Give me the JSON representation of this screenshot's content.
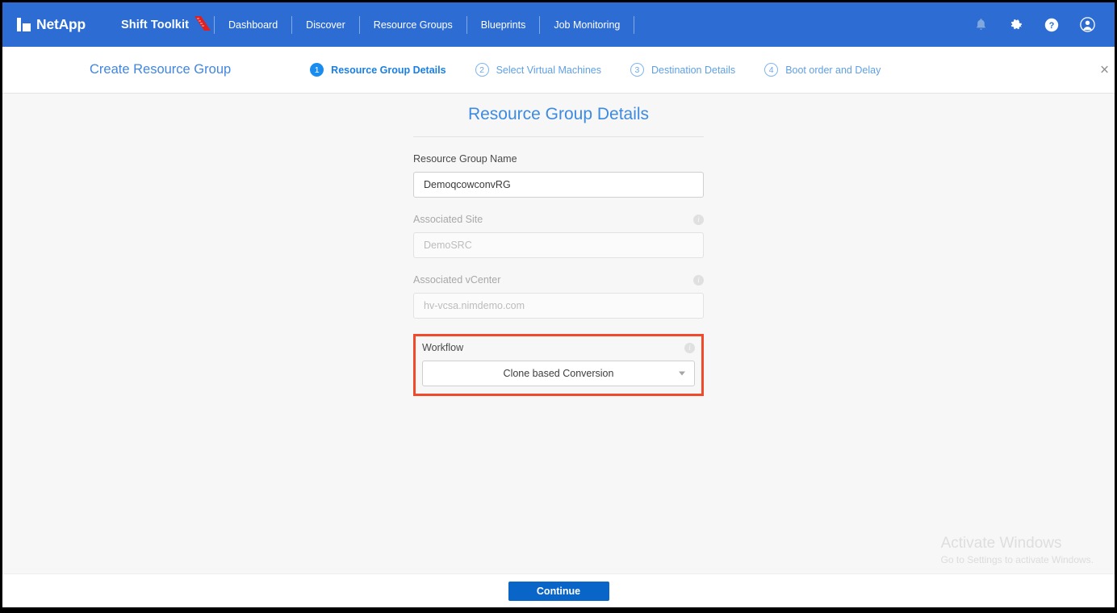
{
  "topnav": {
    "brand": "NetApp",
    "product": "Shift Toolkit",
    "links": [
      {
        "label": "Dashboard"
      },
      {
        "label": "Discover"
      },
      {
        "label": "Resource Groups"
      },
      {
        "label": "Blueprints"
      },
      {
        "label": "Job Monitoring"
      }
    ],
    "icons": {
      "notifications": "bell-icon",
      "settings": "gear-icon",
      "help": "help-icon",
      "account": "account-icon"
    },
    "colors": {
      "background": "#2d6cd2",
      "text": "#ffffff",
      "ribbon": "#e02020"
    }
  },
  "wizard": {
    "title": "Create Resource Group",
    "close_label": "×",
    "steps": [
      {
        "num": "1",
        "label": "Resource Group Details",
        "state": "active"
      },
      {
        "num": "2",
        "label": "Select Virtual Machines",
        "state": "idle"
      },
      {
        "num": "3",
        "label": "Destination Details",
        "state": "idle"
      },
      {
        "num": "4",
        "label": "Boot order and Delay",
        "state": "idle"
      }
    ]
  },
  "form": {
    "title": "Resource Group Details",
    "fields": {
      "resource_group_name": {
        "label": "Resource Group Name",
        "value": "DemoqcowconvRG",
        "placeholder": "Resource Group Name",
        "disabled": false,
        "has_info": false
      },
      "associated_site": {
        "label": "Associated Site",
        "value": "DemoSRC",
        "placeholder": "Associated Site",
        "disabled": true,
        "has_info": true
      },
      "associated_vcenter": {
        "label": "Associated vCenter",
        "value": "hv-vcsa.nimdemo.com",
        "placeholder": "Associated vCenter",
        "disabled": true,
        "has_info": true
      },
      "workflow": {
        "label": "Workflow",
        "value": "Clone based Conversion",
        "options": [
          "Clone based Conversion"
        ],
        "disabled": false,
        "has_info": true,
        "highlighted": true,
        "highlight_color": "#f04a2a"
      }
    },
    "info_icon_glyph": "i"
  },
  "footer": {
    "continue_label": "Continue",
    "accent": "#0a65c8"
  },
  "watermark": {
    "title": "Activate Windows",
    "subtitle": "Go to Settings to activate Windows."
  }
}
